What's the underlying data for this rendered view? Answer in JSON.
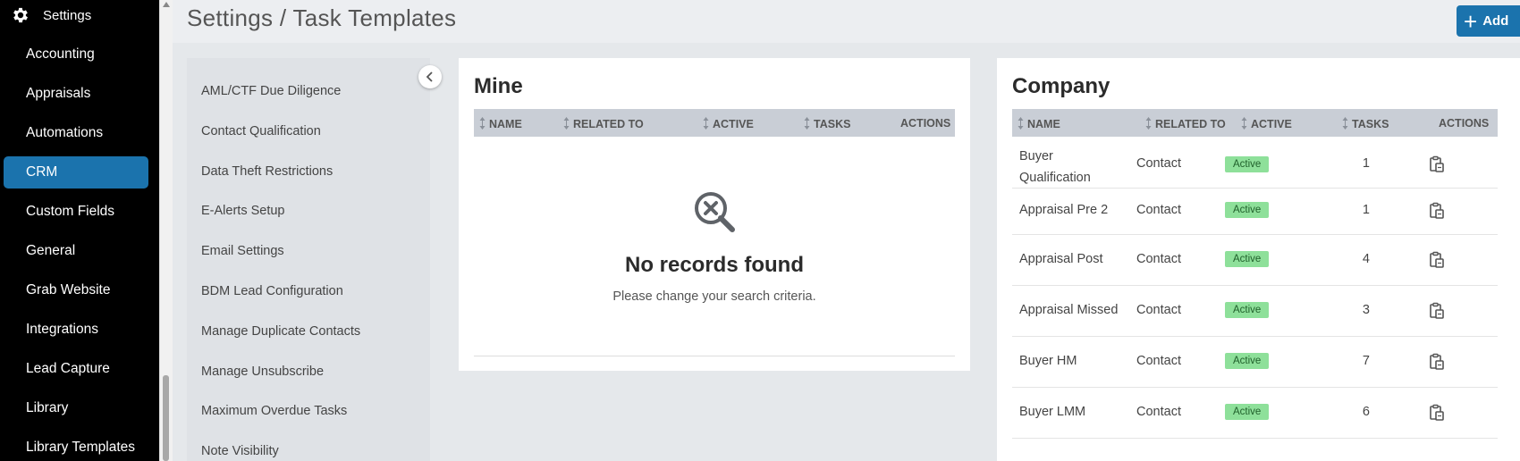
{
  "sidebar": {
    "header": "Settings",
    "items": [
      {
        "label": "Accounting"
      },
      {
        "label": "Appraisals"
      },
      {
        "label": "Automations"
      },
      {
        "label": "CRM",
        "active": true
      },
      {
        "label": "Custom Fields"
      },
      {
        "label": "General"
      },
      {
        "label": "Grab Website"
      },
      {
        "label": "Integrations"
      },
      {
        "label": "Lead Capture"
      },
      {
        "label": "Library"
      },
      {
        "label": "Library Templates"
      }
    ]
  },
  "header": {
    "title": "Settings / Task Templates",
    "add_label": "Add"
  },
  "submenu": {
    "items": [
      "AML/CTF Due Diligence",
      "Contact Qualification",
      "Data Theft Restrictions",
      "E-Alerts Setup",
      "Email Settings",
      "BDM Lead Configuration",
      "Manage Duplicate Contacts",
      "Manage Unsubscribe",
      "Maximum Overdue Tasks",
      "Note Visibility"
    ]
  },
  "mine": {
    "title": "Mine",
    "columns": [
      "NAME",
      "RELATED TO",
      "ACTIVE",
      "TASKS",
      "ACTIONS"
    ],
    "empty_title": "No records found",
    "empty_subtitle": "Please change your search criteria."
  },
  "company": {
    "title": "Company",
    "columns": [
      "NAME",
      "RELATED TO",
      "ACTIVE",
      "TASKS",
      "ACTIONS"
    ],
    "rows": [
      {
        "name_line1": "Buyer",
        "name_line2": "Qualification",
        "related": "Contact",
        "status": "Active",
        "tasks": "1"
      },
      {
        "name_line1": "Appraisal Pre 2",
        "name_line2": "",
        "related": "Contact",
        "status": "Active",
        "tasks": "1"
      },
      {
        "name_line1": "Appraisal Post",
        "name_line2": "",
        "related": "Contact",
        "status": "Active",
        "tasks": "4"
      },
      {
        "name_line1": "Appraisal Missed",
        "name_line2": "",
        "related": "Contact",
        "status": "Active",
        "tasks": "3"
      },
      {
        "name_line1": "Buyer HM",
        "name_line2": "",
        "related": "Contact",
        "status": "Active",
        "tasks": "7"
      },
      {
        "name_line1": "Buyer LMM",
        "name_line2": "",
        "related": "Contact",
        "status": "Active",
        "tasks": "6"
      }
    ]
  },
  "colors": {
    "primary": "#1b73ad",
    "active_badge": "#8ee09a",
    "table_header": "#c9ced6"
  }
}
